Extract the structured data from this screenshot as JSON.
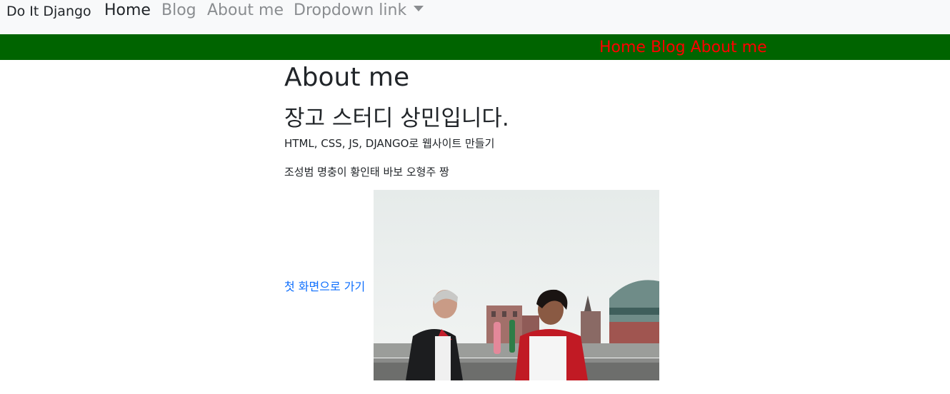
{
  "navbar": {
    "brand": "Do It Django",
    "links": [
      {
        "label": "Home",
        "active": true
      },
      {
        "label": "Blog",
        "active": false
      },
      {
        "label": "About me",
        "active": false
      },
      {
        "label": "Dropdown link",
        "active": false
      }
    ],
    "dropdown_icon": "caret-down-icon"
  },
  "sub_nav": {
    "background": "#006400",
    "link_color": "#ff0000",
    "links": [
      "Home",
      "Blog",
      "About me"
    ]
  },
  "main": {
    "title": "About me",
    "subtitle": "장고 스터디 상민입니다.",
    "paragraphs": [
      "HTML, CSS, JS, DJANGO로 웹사이트 만들기",
      "조성범 명충이 황인태 바보 오형주 짱"
    ],
    "back_link": "첫 화면으로 가기",
    "image": "photo-two-people-toasting-drinks-on-rooftop"
  },
  "colors": {
    "navbar_bg": "#f8f9fa",
    "link_blue": "#0d6efd",
    "muted_text": "#8a8d90"
  }
}
